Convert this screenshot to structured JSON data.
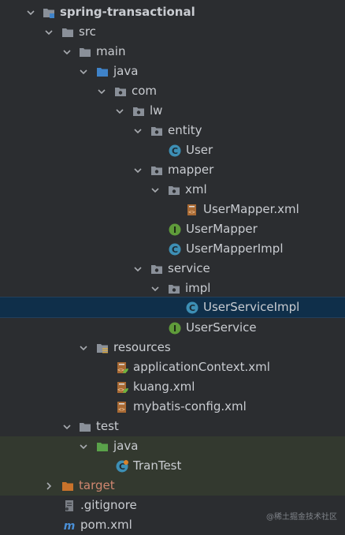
{
  "tree": {
    "project_name": "spring-transactional",
    "src": "src",
    "main": "main",
    "java_main": "java",
    "com": "com",
    "lw": "lw",
    "entity": "entity",
    "user": "User",
    "mapper": "mapper",
    "xml": "xml",
    "user_mapper_xml": "UserMapper.xml",
    "user_mapper": "UserMapper",
    "user_mapper_impl": "UserMapperImpl",
    "service": "service",
    "impl": "impl",
    "user_service_impl": "UserServiceImpl",
    "user_service": "UserService",
    "resources": "resources",
    "app_context_xml": "applicationContext.xml",
    "kuang_xml": "kuang.xml",
    "mybatis_config_xml": "mybatis-config.xml",
    "test": "test",
    "java_test": "java",
    "tran_test": "TranTest",
    "target": "target",
    "gitignore": ".gitignore",
    "pom_xml": "pom.xml"
  },
  "watermark": "@稀土掘金技术社区",
  "colors": {
    "background": "#2b2d30",
    "selection": "#0f2f4a",
    "test_row": "#33392f",
    "class_icon": "#3d8fb5",
    "interface_icon": "#5f9b3a",
    "folder": "#8a9099",
    "source_folder": "#3f83c9",
    "test_folder": "#5aa24a",
    "target_folder": "#c9732b"
  }
}
